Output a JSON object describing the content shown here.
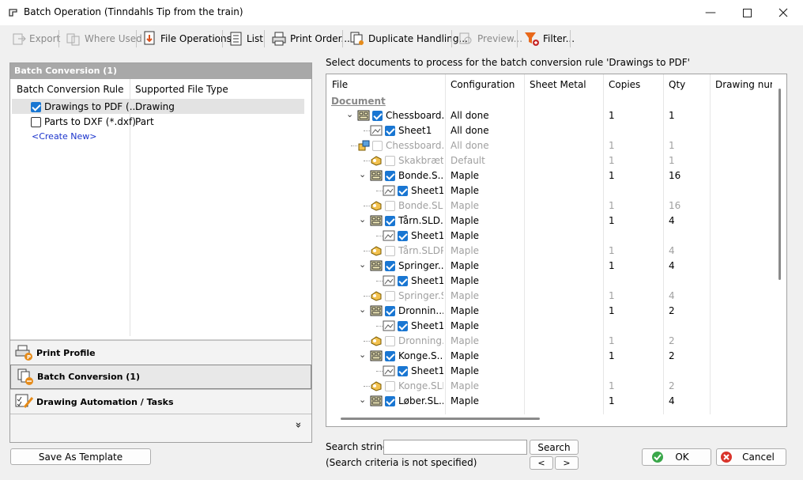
{
  "window": {
    "title": "Batch Operation (Tinndahls Tip from the train)"
  },
  "toolbar": {
    "export": "Export",
    "where_used": "Where Used",
    "file_operations": "File Operations",
    "list": "List",
    "print_order": "Print Order...",
    "duplicate_handling": "Duplicate Handling...",
    "preview": "Preview...",
    "filter": "Filter..."
  },
  "left": {
    "header": "Batch Conversion (1)",
    "col_rule": "Batch Conversion Rule",
    "col_type": "Supported File Type",
    "rules": [
      {
        "name": "Drawings to PDF (...",
        "type": "Drawing",
        "checked": true
      },
      {
        "name": "Parts to DXF (*.dxf)",
        "type": "Part",
        "checked": false
      }
    ],
    "create_new": "<Create New>",
    "sections": {
      "print_profile": "Print Profile",
      "batch_conversion": "Batch Conversion (1)",
      "drawing_automation": "Drawing Automation / Tasks"
    },
    "expand": "»"
  },
  "save_template": "Save As Template",
  "main": {
    "prompt": "Select documents to process for the batch conversion rule 'Drawings to PDF'",
    "columns": {
      "file": "File",
      "configuration": "Configuration",
      "sheet_metal": "Sheet Metal",
      "copies": "Copies",
      "qty": "Qty",
      "drawing_num": "Drawing num"
    },
    "group": "Document",
    "rows": [
      {
        "name": "Chessboard...",
        "config": "All done",
        "copies": "1",
        "qty": "1",
        "kind": "drw",
        "indent": 0,
        "expander": true,
        "checked": true,
        "grey": false
      },
      {
        "name": "Sheet1",
        "config": "All done",
        "copies": "",
        "qty": "",
        "kind": "sheet",
        "indent": 1,
        "expander": false,
        "checked": true,
        "grey": false
      },
      {
        "name": "Chessboard.SL...",
        "config": "All done",
        "copies": "1",
        "qty": "1",
        "kind": "asm",
        "indent": 0,
        "expander": false,
        "checked": false,
        "grey": true
      },
      {
        "name": "Skakbræt.S...",
        "config": "Default",
        "copies": "1",
        "qty": "1",
        "kind": "part",
        "indent": 1,
        "expander": false,
        "checked": false,
        "grey": true
      },
      {
        "name": "Bonde.S...",
        "config": "Maple",
        "copies": "1",
        "qty": "16",
        "kind": "drw",
        "indent": 1,
        "expander": true,
        "checked": true,
        "grey": false
      },
      {
        "name": "Sheet1",
        "config": "Maple",
        "copies": "",
        "qty": "",
        "kind": "sheet",
        "indent": 2,
        "expander": false,
        "checked": true,
        "grey": false
      },
      {
        "name": "Bonde.SLD...",
        "config": "Maple",
        "copies": "1",
        "qty": "16",
        "kind": "part",
        "indent": 1,
        "expander": false,
        "checked": false,
        "grey": true
      },
      {
        "name": "Tårn.SLD...",
        "config": "Maple",
        "copies": "1",
        "qty": "4",
        "kind": "drw",
        "indent": 1,
        "expander": true,
        "checked": true,
        "grey": false
      },
      {
        "name": "Sheet1",
        "config": "Maple",
        "copies": "",
        "qty": "",
        "kind": "sheet",
        "indent": 2,
        "expander": false,
        "checked": true,
        "grey": false
      },
      {
        "name": "Tårn.SLDPRT",
        "config": "Maple",
        "copies": "1",
        "qty": "4",
        "kind": "part",
        "indent": 1,
        "expander": false,
        "checked": false,
        "grey": true
      },
      {
        "name": "Springer....",
        "config": "Maple",
        "copies": "1",
        "qty": "4",
        "kind": "drw",
        "indent": 1,
        "expander": true,
        "checked": true,
        "grey": false
      },
      {
        "name": "Sheet1",
        "config": "Maple",
        "copies": "",
        "qty": "",
        "kind": "sheet",
        "indent": 2,
        "expander": false,
        "checked": true,
        "grey": false
      },
      {
        "name": "Springer.SL...",
        "config": "Maple",
        "copies": "1",
        "qty": "4",
        "kind": "part",
        "indent": 1,
        "expander": false,
        "checked": false,
        "grey": true
      },
      {
        "name": "Dronnin...",
        "config": "Maple",
        "copies": "1",
        "qty": "2",
        "kind": "drw",
        "indent": 1,
        "expander": true,
        "checked": true,
        "grey": false
      },
      {
        "name": "Sheet1",
        "config": "Maple",
        "copies": "",
        "qty": "",
        "kind": "sheet",
        "indent": 2,
        "expander": false,
        "checked": true,
        "grey": false
      },
      {
        "name": "Dronning.S...",
        "config": "Maple",
        "copies": "1",
        "qty": "2",
        "kind": "part",
        "indent": 1,
        "expander": false,
        "checked": false,
        "grey": true
      },
      {
        "name": "Konge.S...",
        "config": "Maple",
        "copies": "1",
        "qty": "2",
        "kind": "drw",
        "indent": 1,
        "expander": true,
        "checked": true,
        "grey": false
      },
      {
        "name": "Sheet1",
        "config": "Maple",
        "copies": "",
        "qty": "",
        "kind": "sheet",
        "indent": 2,
        "expander": false,
        "checked": true,
        "grey": false
      },
      {
        "name": "Konge.SLD...",
        "config": "Maple",
        "copies": "1",
        "qty": "2",
        "kind": "part",
        "indent": 1,
        "expander": false,
        "checked": false,
        "grey": true
      },
      {
        "name": "Løber.SL...",
        "config": "Maple",
        "copies": "1",
        "qty": "4",
        "kind": "drw",
        "indent": 1,
        "expander": true,
        "checked": true,
        "grey": false
      }
    ]
  },
  "search": {
    "label": "Search string:",
    "value": "",
    "button": "Search",
    "status": "(Search criteria is not specified)",
    "prev": "<",
    "next": ">"
  },
  "buttons": {
    "ok": "OK",
    "cancel": "Cancel"
  }
}
